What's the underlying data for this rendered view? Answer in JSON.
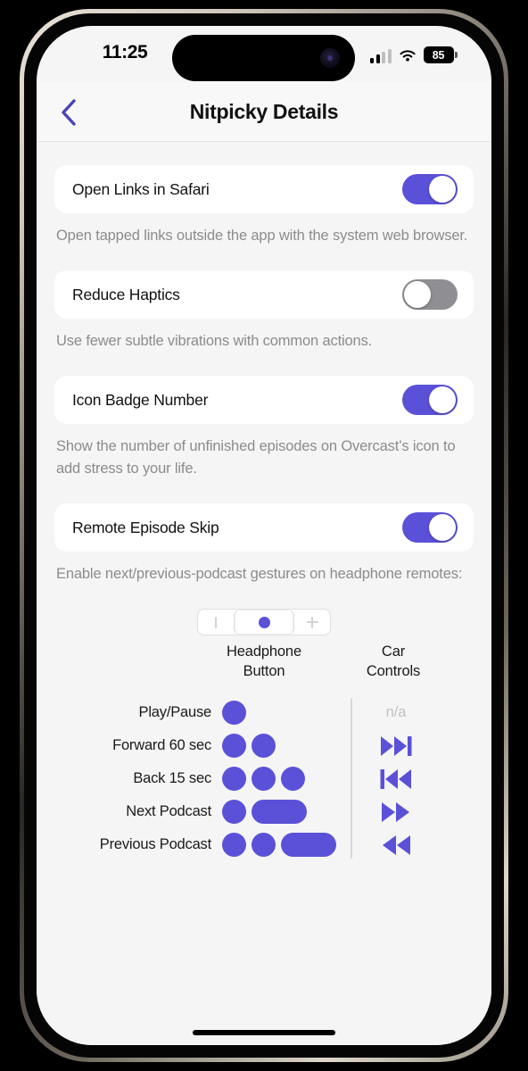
{
  "theme": {
    "accent": "#5b51d8",
    "screen_bg": "#f5f5f5",
    "card_bg": "#ffffff",
    "desc_text": "#8c8c8c",
    "switch_off": "#8e8e93",
    "divider": "#d8d8d8"
  },
  "status_bar": {
    "time": "11:25",
    "cellular_icon": "cellular-bars-icon",
    "wifi_icon": "wifi-icon",
    "battery_level": "85",
    "battery_icon": "battery-icon"
  },
  "nav": {
    "back_icon": "chevron-left-icon",
    "title": "Nitpicky Details"
  },
  "settings": [
    {
      "label": "Open Links in Safari",
      "state": "on",
      "description": "Open tapped links outside the app with the system web browser."
    },
    {
      "label": "Reduce Haptics",
      "state": "off",
      "description": "Use fewer subtle vibrations with common actions."
    },
    {
      "label": "Icon Badge Number",
      "state": "on",
      "description": "Show the number of unfinished episodes on Overcast’s icon to add stress to your life."
    },
    {
      "label": "Remote Episode Skip",
      "state": "on",
      "description": "Enable next/previous-podcast gestures on headphone remotes:"
    }
  ],
  "remote_widget": {
    "minus_label": "minus-icon",
    "center_label": "center-button-dot-icon",
    "plus_label": "plus-icon"
  },
  "gesture_table": {
    "columns": {
      "headphone": "Headphone\nButton",
      "headphone_line1": "Headphone",
      "headphone_line2": "Button",
      "car": "Car\nControls",
      "car_line1": "Car",
      "car_line2": "Controls"
    },
    "rows": [
      {
        "label": "Play/Pause",
        "taps": [
          "dot"
        ],
        "car": "n/a",
        "car_icon": "none"
      },
      {
        "label": "Forward 60 sec",
        "taps": [
          "dot",
          "dot"
        ],
        "car": "",
        "car_icon": "skip-forward-icon"
      },
      {
        "label": "Back 15 sec",
        "taps": [
          "dot",
          "dot",
          "dot"
        ],
        "car": "",
        "car_icon": "skip-backward-icon"
      },
      {
        "label": "Next Podcast",
        "taps": [
          "dot",
          "hold"
        ],
        "car": "",
        "car_icon": "fast-forward-icon"
      },
      {
        "label": "Previous Podcast",
        "taps": [
          "dot",
          "dot",
          "hold"
        ],
        "car": "",
        "car_icon": "rewind-icon"
      }
    ]
  },
  "home_indicator": "home-indicator"
}
